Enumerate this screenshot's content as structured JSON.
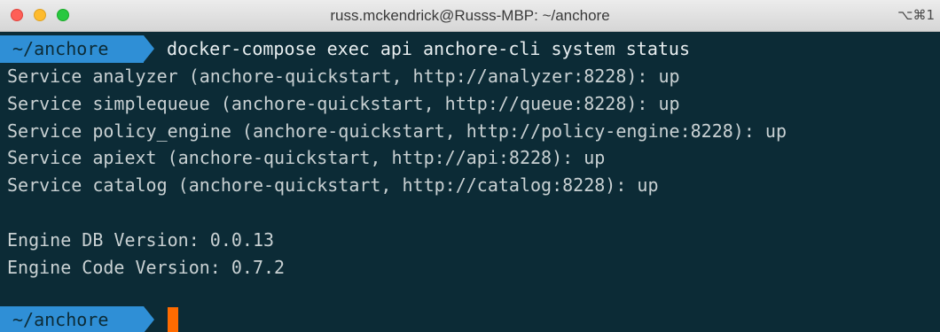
{
  "window": {
    "title": "russ.mckendrick@Russs-MBP: ~/anchore",
    "shortcut": "⌥⌘1"
  },
  "terminal": {
    "prompt_path": "~/anchore",
    "command": "docker-compose exec api anchore-cli system status",
    "output": [
      "Service analyzer (anchore-quickstart, http://analyzer:8228): up",
      "Service simplequeue (anchore-quickstart, http://queue:8228): up",
      "Service policy_engine (anchore-quickstart, http://policy-engine:8228): up",
      "Service apiext (anchore-quickstart, http://api:8228): up",
      "Service catalog (anchore-quickstart, http://catalog:8228): up",
      "",
      "Engine DB Version: 0.0.13",
      "Engine Code Version: 0.7.2"
    ],
    "second_prompt_path": "~/anchore"
  },
  "colors": {
    "background": "#0c2b36",
    "prompt_segment": "#2f8fd6",
    "cursor": "#ff6b00",
    "text": "#c9d1d3"
  }
}
